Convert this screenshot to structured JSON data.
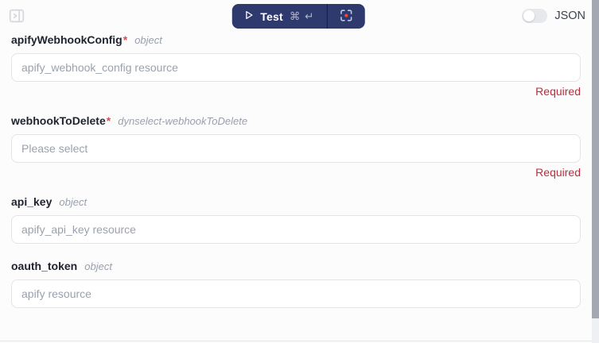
{
  "colors": {
    "accent_navy": "#2e3a6e",
    "error_red": "#bb2d3b",
    "asterisk_red": "#e5484d",
    "red_dot": "#e5484d",
    "input_border": "#e4e4e8",
    "placeholder": "#9aa1ad",
    "background": "#fcfcfd"
  },
  "topbar": {
    "panel_icon": "panel-toggle-icon",
    "test_button": {
      "play_icon": "play-icon",
      "label": "Test",
      "shortcut": "⌘ ↵",
      "focus_icon": "focus-target-icon"
    },
    "json_toggle": {
      "label": "JSON",
      "state": "off"
    }
  },
  "fields": [
    {
      "name": "apifyWebhookConfig",
      "required_marker": "*",
      "type_hint": "object",
      "placeholder": "apify_webhook_config resource",
      "error": "Required"
    },
    {
      "name": "webhookToDelete",
      "required_marker": "*",
      "type_hint": "dynselect-webhookToDelete",
      "placeholder": "Please select",
      "error": "Required"
    },
    {
      "name": "api_key",
      "type_hint": "object",
      "placeholder": "apify_api_key resource"
    },
    {
      "name": "oauth_token",
      "type_hint": "object",
      "placeholder": "apify resource"
    }
  ]
}
